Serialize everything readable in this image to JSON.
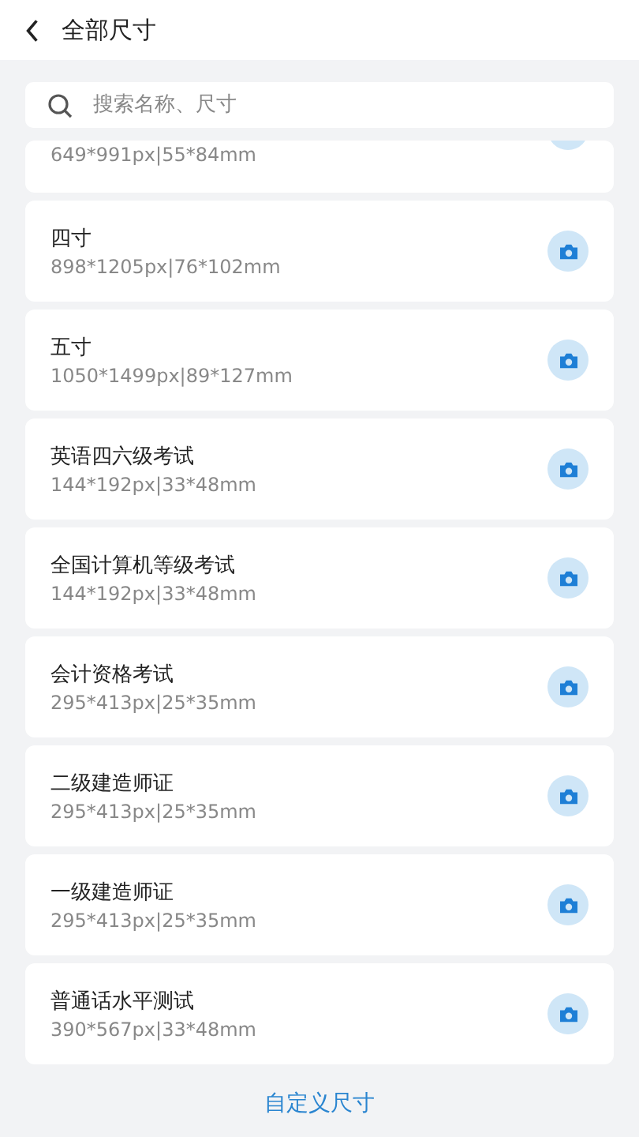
{
  "header": {
    "title": "全部尺寸"
  },
  "search": {
    "placeholder": "搜索名称、尺寸"
  },
  "sizes": [
    {
      "kind": "partial",
      "size": "649*991px|55*84mm"
    },
    {
      "kind": "full",
      "name": "四寸",
      "size": "898*1205px|76*102mm"
    },
    {
      "kind": "full",
      "name": "五寸",
      "size": "1050*1499px|89*127mm"
    },
    {
      "kind": "full",
      "name": "英语四六级考试",
      "size": "144*192px|33*48mm"
    },
    {
      "kind": "full",
      "name": "全国计算机等级考试",
      "size": "144*192px|33*48mm"
    },
    {
      "kind": "full",
      "name": "会计资格考试",
      "size": "295*413px|25*35mm"
    },
    {
      "kind": "full",
      "name": "二级建造师证",
      "size": "295*413px|25*35mm"
    },
    {
      "kind": "full",
      "name": "一级建造师证",
      "size": "295*413px|25*35mm"
    },
    {
      "kind": "full",
      "name": "普通话水平测试",
      "size": "390*567px|33*48mm"
    }
  ],
  "custom_link": "自定义尺寸"
}
